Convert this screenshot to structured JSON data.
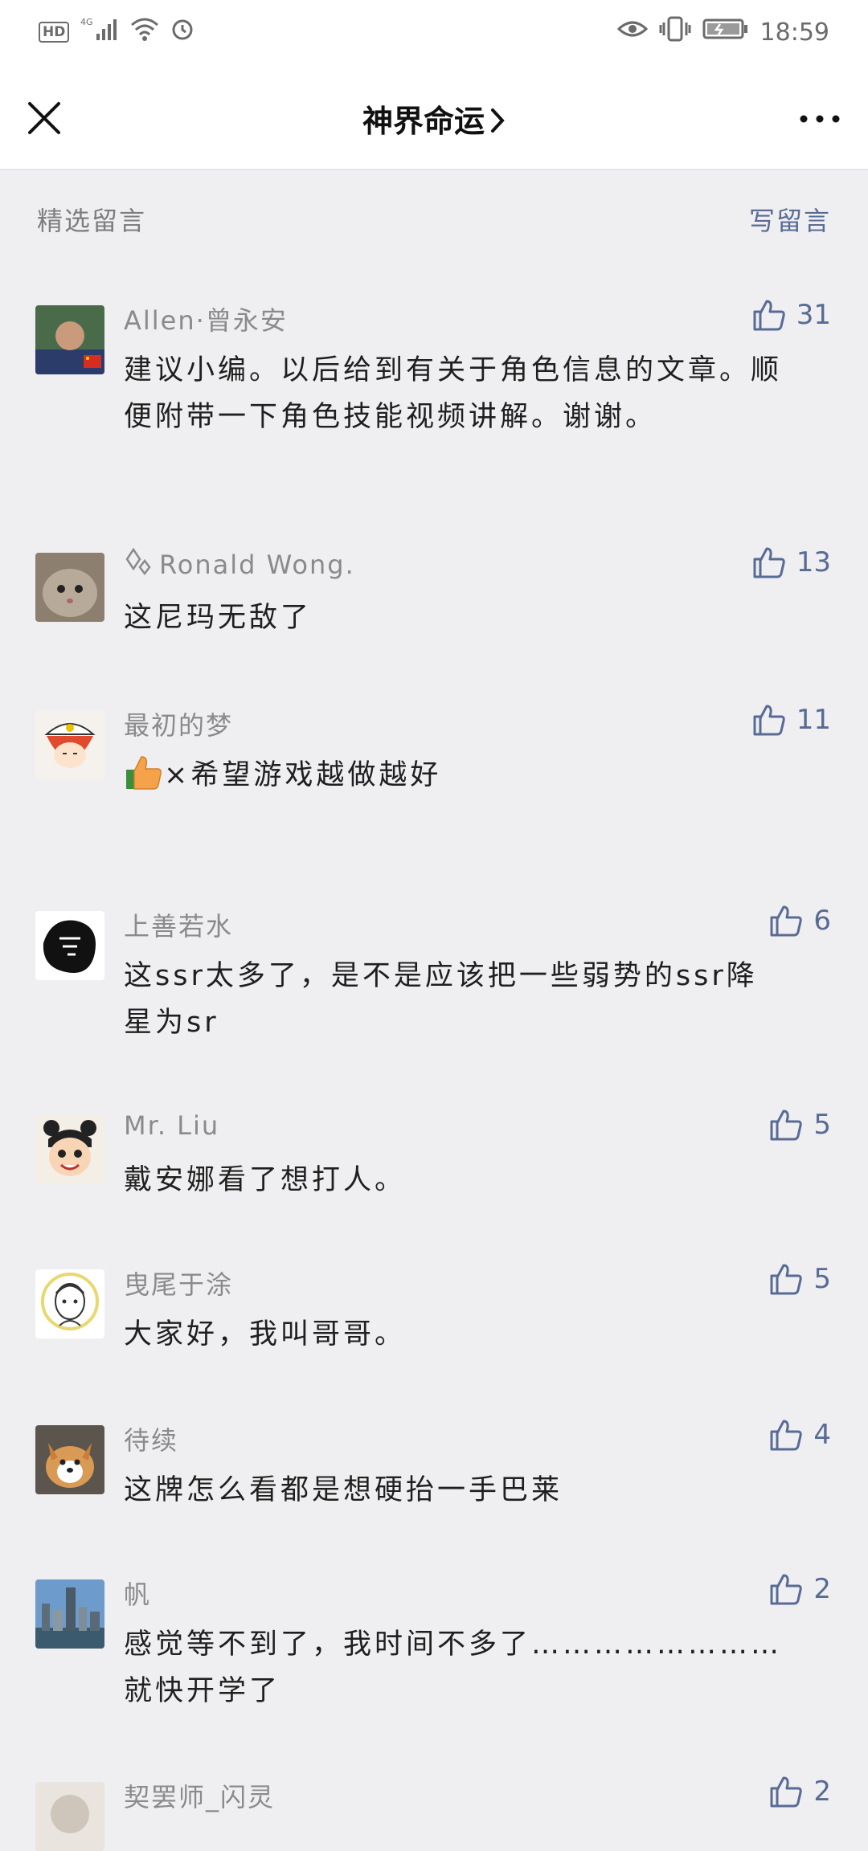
{
  "status": {
    "hd": "HD",
    "network": "4G",
    "time": "18:59"
  },
  "nav": {
    "title": "神界命运",
    "close_icon": "close-icon",
    "more_icon": "more-icon"
  },
  "section": {
    "title": "精选留言",
    "write_label": "写留言"
  },
  "colors": {
    "accent": "#586b95",
    "background": "#efeff1"
  },
  "comments": [
    {
      "nickname": "Allen·曾永安",
      "likes": "31",
      "text": "建议小编。以后给到有关于角色信息的文章。顺便附带一下角色技能视频讲解。谢谢。"
    },
    {
      "nickname": "Ronald Wong.",
      "likes": "13",
      "text": "这尼玛无敌了"
    },
    {
      "nickname": "最初的梦",
      "likes": "11",
      "text_prefix_icon": "thumbs-up-emoji",
      "text": "×希望游戏越做越好"
    },
    {
      "nickname": "上善若水",
      "likes": "6",
      "text": "这ssr太多了，是不是应该把一些弱势的ssr降星为sr"
    },
    {
      "nickname": "Mr. Liu",
      "likes": "5",
      "text": "戴安娜看了想打人。"
    },
    {
      "nickname": "曳尾于涂",
      "likes": "5",
      "text": "大家好，我叫哥哥。"
    },
    {
      "nickname": "待续",
      "likes": "4",
      "text": "这牌怎么看都是想硬抬一手巴莱"
    },
    {
      "nickname": "帆",
      "likes": "2",
      "text": "感觉等不到了，我时间不多了……………………就快开学了"
    },
    {
      "nickname": "契罢师_闪灵",
      "likes": "2",
      "text": ""
    }
  ]
}
